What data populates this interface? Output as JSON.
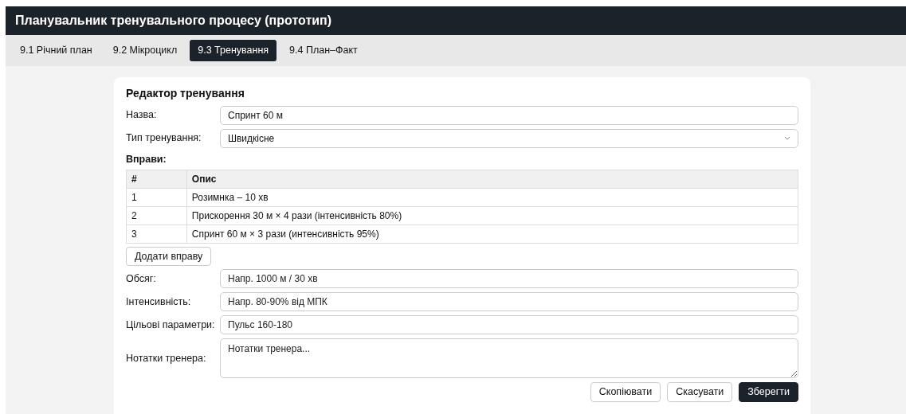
{
  "window": {
    "title": "Планувальник тренувального процесу (прототип)"
  },
  "tabs": [
    {
      "label": "9.1 Річний план",
      "selected": false
    },
    {
      "label": "9.2 Мікроцикл",
      "selected": false
    },
    {
      "label": "9.3 Тренування",
      "selected": true
    },
    {
      "label": "9.4 План–Факт",
      "selected": false
    }
  ],
  "editor": {
    "title": "Редактор тренування",
    "name_field": {
      "label": "Назва:",
      "value": "Спринт 60 м"
    },
    "type_field": {
      "label": "Тип тренування:",
      "value": "Швидкісне"
    },
    "exercises_label": "Вправи:",
    "table": {
      "columns": [
        "#",
        "Опис"
      ],
      "rows": [
        [
          "1",
          "Розимнка – 10 хв"
        ],
        [
          "2",
          "Прискорення 30 м × 4 рази (інтенсивність 80%)"
        ],
        [
          "3",
          "Спринт 60 м × 3 рази (интенсивність 95%)"
        ]
      ]
    },
    "add_button": "Додати вправу",
    "fields": [
      {
        "label": "Обсяг:",
        "placeholder": "Напр. 1000 м / 30 хв",
        "kind": "input"
      },
      {
        "label": "Інтенсивність:",
        "placeholder": "Напр. 80-90% від МПК",
        "kind": "input"
      },
      {
        "label": "Цільові параметри:",
        "placeholder": "Пульс 160-180",
        "kind": "input"
      },
      {
        "label": "Нотатки тренера:",
        "placeholder": "Нотатки тренера...",
        "kind": "textarea"
      }
    ],
    "buttons": [
      {
        "label": "Скопіювати",
        "primary": false
      },
      {
        "label": "Скасувати",
        "primary": false
      },
      {
        "label": "Зберегти",
        "primary": true
      }
    ]
  }
}
